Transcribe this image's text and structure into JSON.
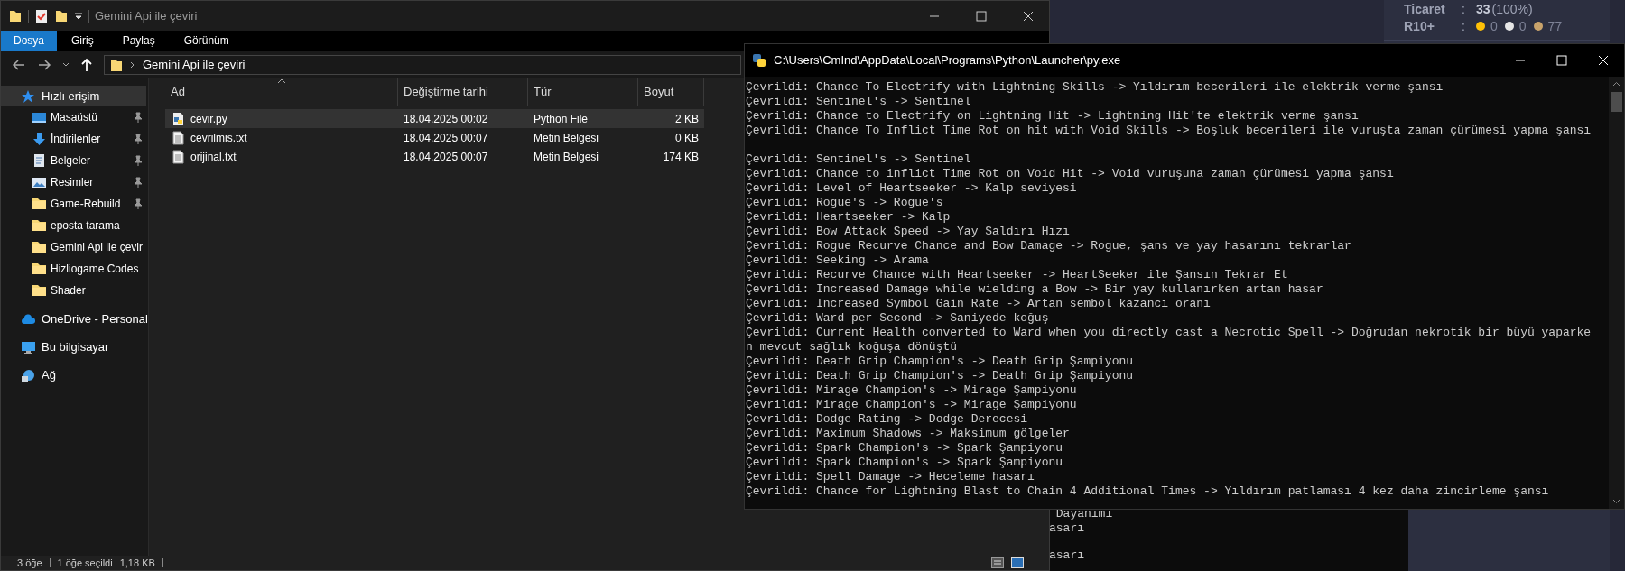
{
  "web_panel": {
    "rows": [
      {
        "kind": "stat",
        "label": "Ticaret",
        "separator": ":",
        "value": "33",
        "note": "(100%)"
      },
      {
        "kind": "dots",
        "label": "R10+",
        "separator": ":",
        "counts": [
          {
            "color": "#ffc107",
            "value": "0"
          },
          {
            "color": "#e6e6e6",
            "value": "0"
          },
          {
            "color": "#c9a36b",
            "value": "77"
          }
        ]
      }
    ]
  },
  "back_console": {
    "blocks": [
      [
        " Dayanımı",
        "asarı"
      ],
      [
        "asarı"
      ]
    ]
  },
  "explorer": {
    "title": "Gemini Api ile çeviri",
    "ribbon_tabs": [
      {
        "label": "Dosya",
        "selected": true
      },
      {
        "label": "Giriş",
        "selected": false
      },
      {
        "label": "Paylaş",
        "selected": false
      },
      {
        "label": "Görünüm",
        "selected": false
      }
    ],
    "address": "Gemini Api ile çeviri",
    "sidebar": {
      "items": [
        {
          "label": "Hızlı erişim",
          "kind": "star",
          "selected": true,
          "children": [
            {
              "label": "Masaüstü",
              "kind": "desktop",
              "pinned": true
            },
            {
              "label": "İndirilenler",
              "kind": "download",
              "pinned": true
            },
            {
              "label": "Belgeler",
              "kind": "documents",
              "pinned": true
            },
            {
              "label": "Resimler",
              "kind": "pictures",
              "pinned": true
            },
            {
              "label": "Game-Rebuild",
              "kind": "folder",
              "pinned": true
            },
            {
              "label": "eposta tarama",
              "kind": "folder",
              "pinned": false
            },
            {
              "label": "Gemini Api ile çevir",
              "kind": "folder",
              "pinned": false
            },
            {
              "label": "Hizliogame Codes",
              "kind": "folder",
              "pinned": false
            },
            {
              "label": "Shader",
              "kind": "folder",
              "pinned": false
            }
          ]
        },
        {
          "label": "OneDrive - Personal",
          "kind": "cloud",
          "selected": false
        },
        {
          "label": "Bu bilgisayar",
          "kind": "computer",
          "selected": false
        },
        {
          "label": "Ağ",
          "kind": "network",
          "selected": false
        }
      ]
    },
    "columns": [
      "Ad",
      "Değiştirme tarihi",
      "Tür",
      "Boyut"
    ],
    "rows": [
      {
        "kind": "python",
        "selected": true,
        "cells": [
          "cevir.py",
          "18.04.2025 00:02",
          "Python File",
          "2 KB"
        ]
      },
      {
        "kind": "text",
        "selected": false,
        "cells": [
          "cevrilmis.txt",
          "18.04.2025 00:07",
          "Metin Belgesi",
          "0 KB"
        ]
      },
      {
        "kind": "text",
        "selected": false,
        "cells": [
          "orijinal.txt",
          "18.04.2025 00:07",
          "Metin Belgesi",
          "174 KB"
        ]
      }
    ],
    "status_bar": [
      "3 öğe",
      "1 öğe seçildi",
      "1,18 KB"
    ]
  },
  "console": {
    "title": "C:\\Users\\CmInd\\AppData\\Local\\Programs\\Python\\Launcher\\py.exe",
    "blocks": [
      [
        "Çevrildi: Chance To Electrify with Lightning Skills -> Yıldırım becerileri ile elektrik verme şansı",
        "Çevrildi: Sentinel's -> Sentinel",
        "Çevrildi: Chance to Electrify on Lightning Hit -> Lightning Hit'te elektrik verme şansı",
        "Çevrildi: Chance To Inflict Time Rot on hit with Void Skills -> Boşluk becerileri ile vuruşta zaman çürümesi yapma şansı"
      ],
      [
        "Çevrildi: Sentinel's -> Sentinel",
        "Çevrildi: Chance to inflict Time Rot on Void Hit -> Void vuruşuna zaman çürümesi yapma şansı",
        "Çevrildi: Level of Heartseeker -> Kalp seviyesi",
        "Çevrildi: Rogue's -> Rogue's",
        "Çevrildi: Heartseeker -> Kalp",
        "Çevrildi: Bow Attack Speed -> Yay Saldırı Hızı",
        "Çevrildi: Rogue Recurve Chance and Bow Damage -> Rogue, şans ve yay hasarını tekrarlar",
        "Çevrildi: Seeking -> Arama",
        "Çevrildi: Recurve Chance with Heartseeker -> HeartSeeker ile Şansın Tekrar Et",
        "Çevrildi: Increased Damage while wielding a Bow -> Bir yay kullanırken artan hasar",
        "Çevrildi: Increased Symbol Gain Rate -> Artan sembol kazancı oranı",
        "Çevrildi: Ward per Second -> Saniyede koğuş",
        "Çevrildi: Current Health converted to Ward when you directly cast a Necrotic Spell -> Doğrudan nekrotik bir büyü yaparke",
        "n mevcut sağlık koğuşa dönüştü",
        "Çevrildi: Death Grip Champion's -> Death Grip Şampiyonu",
        "Çevrildi: Death Grip Champion's -> Death Grip Şampiyonu",
        "Çevrildi: Mirage Champion's -> Mirage Şampiyonu",
        "Çevrildi: Mirage Champion's -> Mirage Şampiyonu",
        "Çevrildi: Dodge Rating -> Dodge Derecesi",
        "Çevrildi: Maximum Shadows -> Maksimum gölgeler",
        "Çevrildi: Spark Champion's -> Spark Şampiyonu",
        "Çevrildi: Spark Champion's -> Spark Şampiyonu",
        "Çevrildi: Spell Damage -> Heceleme hasarı",
        "Çevrildi: Chance for Lightning Blast to Chain 4 Additional Times -> Yıldırım patlaması 4 kez daha zincirleme şansı"
      ]
    ]
  }
}
